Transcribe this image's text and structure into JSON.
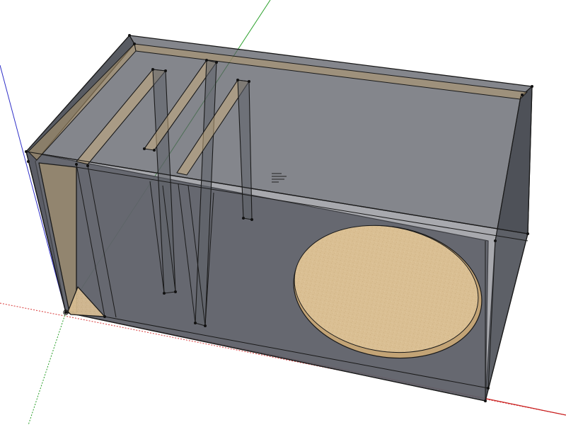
{
  "colors": {
    "background": "#ffffff",
    "axis_red": "#d02020",
    "axis_green": "#2aa02a",
    "axis_blue": "#3030c8",
    "edge": "#1a1a1a",
    "glass": "#5b5e66",
    "wood": "#d8bd91"
  },
  "icons": [
    "origin-icon",
    "note-marker-icon"
  ]
}
